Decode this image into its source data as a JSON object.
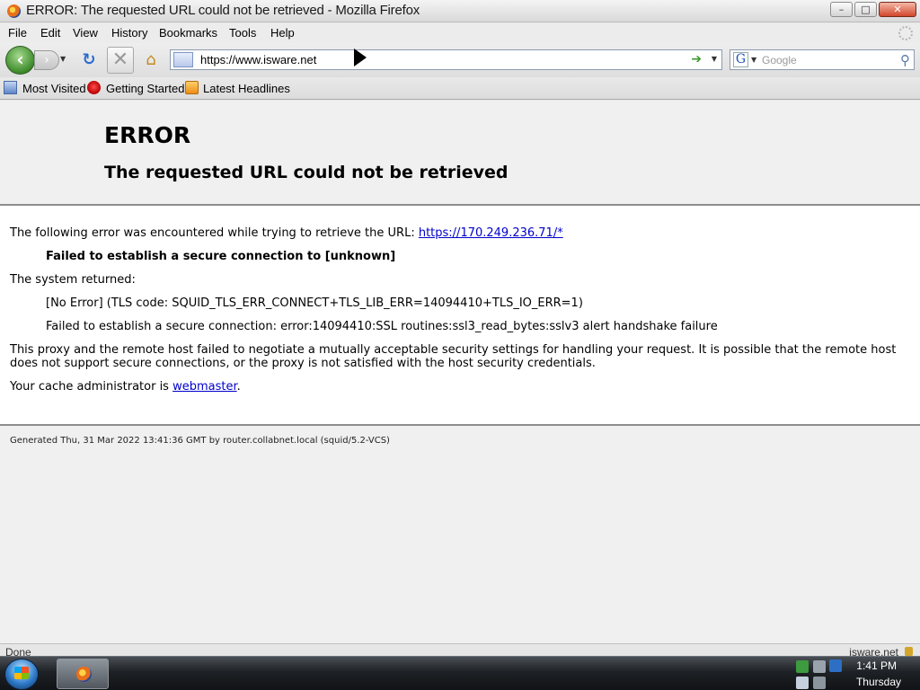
{
  "window": {
    "title": "ERROR: The requested URL could not be retrieved - Mozilla Firefox",
    "minimize": "–",
    "maximize": "□",
    "close": "✕"
  },
  "menu": [
    "File",
    "Edit",
    "View",
    "History",
    "Bookmarks",
    "Tools",
    "Help"
  ],
  "nav": {
    "url": "https://www.isware.net",
    "search_placeholder": "Google",
    "search_engine_icon": "G"
  },
  "bookmarks": [
    "Most Visited",
    "Getting Started",
    "Latest Headlines"
  ],
  "page": {
    "h1": "ERROR",
    "h2": "The requested URL could not be retrieved",
    "line1_prefix": "The following error was encountered while trying to retrieve the URL: ",
    "line1_link": "https://170.249.236.71/*",
    "line2": "Failed to establish a secure connection to [unknown]",
    "line3": "The system returned:",
    "line4": "[No Error] (TLS code: SQUID_TLS_ERR_CONNECT+TLS_LIB_ERR=14094410+TLS_IO_ERR=1)",
    "line5": "Failed to establish a secure connection: error:14094410:SSL routines:ssl3_read_bytes:sslv3 alert handshake failure",
    "para": "This proxy and the remote host failed to negotiate a mutually acceptable security settings for handling your request. It is possible that the remote host does not support secure connections, or the proxy is not satisfied with the host security credentials.",
    "admin_prefix": "Your cache administrator is ",
    "admin_link": "webmaster",
    "admin_suffix": ".",
    "generated": "Generated Thu, 31 Mar 2022 13:41:36 GMT by router.collabnet.local (squid/5.2-VCS)"
  },
  "status": {
    "text": "Done",
    "host": "isware.net"
  },
  "taskbar": {
    "time": "1:41 PM",
    "day": "Thursday"
  },
  "icons": {
    "back": "back-arrow-icon",
    "forward": "forward-arrow-icon",
    "reload": "reload-icon",
    "stop": "stop-icon",
    "home": "home-icon",
    "go": "go-arrow-icon",
    "search": "magnifier-icon",
    "lock": "padlock-icon"
  }
}
